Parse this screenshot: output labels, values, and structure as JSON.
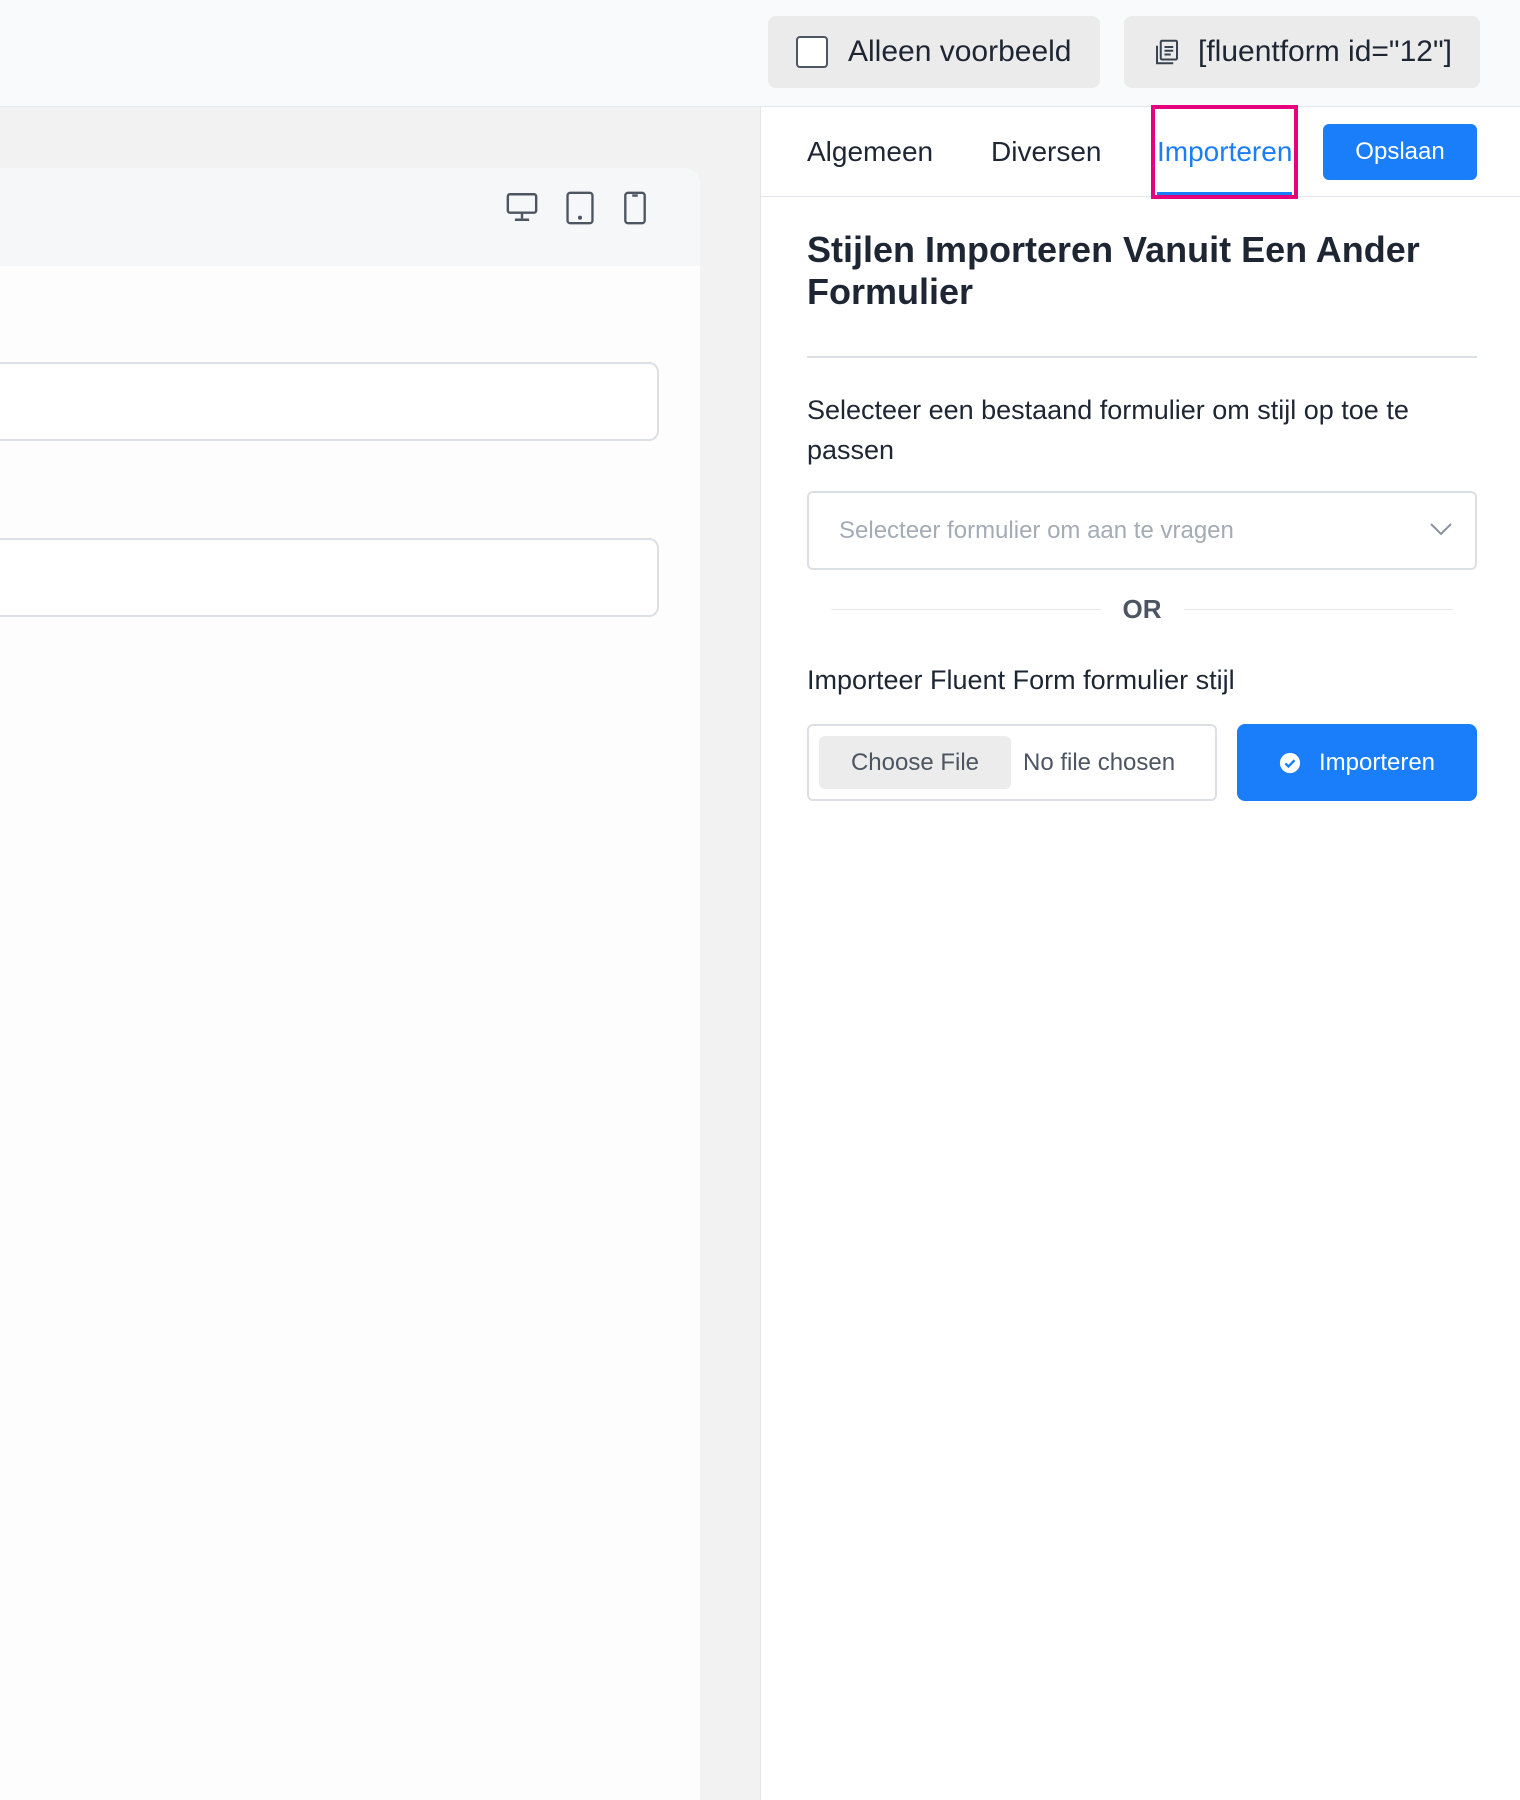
{
  "topbar": {
    "preview_label": "Alleen voorbeeld",
    "shortcode": "[fluentform id=\"12\"]"
  },
  "panel": {
    "tabs": [
      {
        "label": "Algemeen"
      },
      {
        "label": "Diversen"
      },
      {
        "label": "Importeren"
      }
    ],
    "save_label": "Opslaan",
    "title": "Stijlen Importeren Vanuit Een Ander Formulier",
    "select_label": "Selecteer een bestaand formulier om stijl op toe te passen",
    "select_placeholder": "Selecteer formulier om aan te vragen",
    "or_text": "OR",
    "import_label": "Importeer Fluent Form formulier stijl",
    "choose_file": "Choose File",
    "no_file": "No file chosen",
    "import_button": "Importeren"
  },
  "colors": {
    "accent": "#1a7efb",
    "highlight": "#e6007e"
  },
  "icons": [
    "copy-icon",
    "desktop-icon",
    "tablet-icon",
    "mobile-icon",
    "chevron-down-icon",
    "check-circle-icon"
  ]
}
